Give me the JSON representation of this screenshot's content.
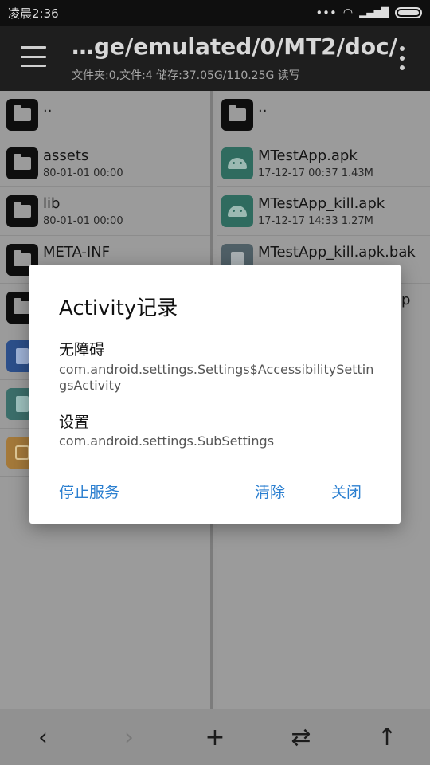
{
  "status": {
    "time": "凌晨2:36",
    "dots": "•••",
    "signal": "▂▄▆█"
  },
  "appbar": {
    "path": "…ge/emulated/0/MT2/doc/",
    "info": "文件夹:0,文件:4  储存:37.05G/110.25G  读写"
  },
  "left_pane": {
    "items": [
      {
        "name": "..",
        "meta": ""
      },
      {
        "name": "assets",
        "meta": "80-01-01 00:00"
      },
      {
        "name": "lib",
        "meta": "80-01-01 00:00"
      },
      {
        "name": "META-INF",
        "meta": ""
      }
    ]
  },
  "right_pane": {
    "items": [
      {
        "name": "..",
        "meta": ""
      },
      {
        "name": "MTestApp.apk",
        "meta": "17-12-17 00:37  1.43M"
      },
      {
        "name": "MTestApp_kill.apk",
        "meta": "17-12-17 14:33  1.27M"
      },
      {
        "name": "MTestApp_kill.apk.bak",
        "meta": ""
      },
      {
        "name": "p",
        "meta": ""
      }
    ]
  },
  "bottombar": {
    "back": "‹",
    "forward": "›",
    "add": "+",
    "swap": "⇄",
    "up": "↑"
  },
  "dialog": {
    "title": "Activity记录",
    "entries": [
      {
        "label": "无障碍",
        "value": "com.android.settings.Settings$AccessibilitySettingsActivity"
      },
      {
        "label": "设置",
        "value": "com.android.settings.SubSettings"
      }
    ],
    "buttons": {
      "stop": "停止服务",
      "clear": "清除",
      "close": "关闭"
    }
  }
}
